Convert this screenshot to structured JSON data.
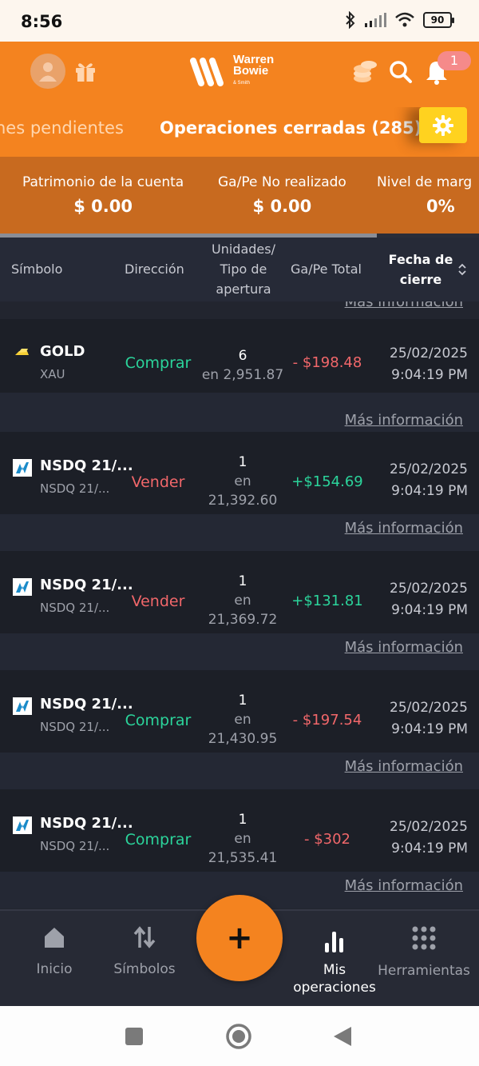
{
  "status_bar": {
    "time": "8:56",
    "battery": "90"
  },
  "header": {
    "logo_line1": "Warren",
    "logo_line2": "Bowie",
    "logo_line3": "& Smith",
    "notification_count": "1"
  },
  "tabs": {
    "pending": "nes pendientes",
    "closed": "Operaciones cerradas (285)"
  },
  "summary": [
    {
      "label": "Patrimonio de la cuenta",
      "value": "$ 0.00"
    },
    {
      "label": "Ga/Pe No realizado",
      "value": "$ 0.00"
    },
    {
      "label": "Nivel de marg",
      "value": "0%"
    }
  ],
  "table_header": {
    "symbol": "Símbolo",
    "direction": "Dirección",
    "units_1": "Unidades/",
    "units_2": "Tipo de",
    "units_3": "apertura",
    "pnl": "Ga/Pe Total",
    "date_1": "Fecha de",
    "date_2": "cierre"
  },
  "partial_more": "Más información",
  "rows": [
    {
      "symbol": "GOLD",
      "sub": "XAU",
      "direction": "Comprar",
      "units": "6",
      "open_1": "en 2,951.87",
      "open_2": "",
      "pnl": "- $198.48",
      "date": "25/02/2025",
      "time": "9:04:19 PM",
      "more": "Más información"
    },
    {
      "symbol": "NSDQ 21/...",
      "sub": "NSDQ 21/...",
      "direction": "Vender",
      "units": "1",
      "open_1": "en",
      "open_2": "21,392.60",
      "pnl": "+$154.69",
      "date": "25/02/2025",
      "time": "9:04:19 PM",
      "more": "Más información"
    },
    {
      "symbol": "NSDQ 21/...",
      "sub": "NSDQ 21/...",
      "direction": "Vender",
      "units": "1",
      "open_1": "en",
      "open_2": "21,369.72",
      "pnl": "+$131.81",
      "date": "25/02/2025",
      "time": "9:04:19 PM",
      "more": "Más información"
    },
    {
      "symbol": "NSDQ 21/...",
      "sub": "NSDQ 21/...",
      "direction": "Comprar",
      "units": "1",
      "open_1": "en",
      "open_2": "21,430.95",
      "pnl": "- $197.54",
      "date": "25/02/2025",
      "time": "9:04:19 PM",
      "more": "Más información"
    },
    {
      "symbol": "NSDQ 21/...",
      "sub": "NSDQ 21/...",
      "direction": "Comprar",
      "units": "1",
      "open_1": "en",
      "open_2": "21,535.41",
      "pnl": "- $302",
      "date": "25/02/2025",
      "time": "9:04:19 PM",
      "more": "Más información"
    }
  ],
  "bottom_nav": {
    "home": "Inicio",
    "symbols": "Símbolos",
    "fab": "+",
    "my_ops_1": "Mis",
    "my_ops_2": "operaciones",
    "tools": "Herramientas"
  },
  "colors": {
    "brand": "#f4831f",
    "buy": "#2bd49b",
    "sell": "#f1676a",
    "settings": "#ffd21f"
  }
}
